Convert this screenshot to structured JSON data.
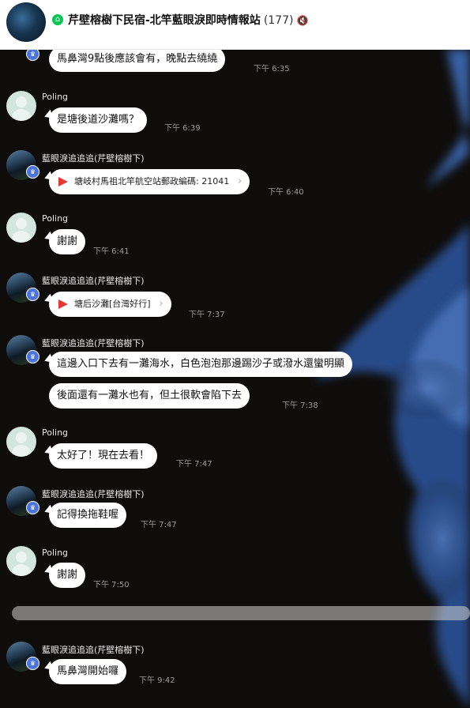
{
  "header": {
    "group_icon": "group-icon",
    "title": "芹壁榕樹下民宿-北竿藍眼淚即時情報站",
    "member_count": "(177)",
    "mute_icon": "speaker-mute-icon"
  },
  "colors": {
    "header_bg": "#ffffff",
    "chat_bg": "#0f0d0b",
    "bubble_bg": "#ffffff",
    "admin_badge": "#4a74d9",
    "group_badge": "#06c755",
    "link_play": "#e53935"
  },
  "messages": [
    {
      "sender": "",
      "text": "馬鼻灣9點後應該會有，晚點去繞繞",
      "time": "下午 6:35"
    },
    {
      "sender": "Poling",
      "text": "是塘後道沙灘嗎？",
      "time": "下午 6:39"
    },
    {
      "sender": "藍眼淚追追追(芹壁榕樹下)",
      "text": "塘岐村馬祖北竿航空站郵政編碼: 21041",
      "time": "下午 6:40"
    },
    {
      "sender": "Poling",
      "text": "謝謝",
      "time": "下午 6:41"
    },
    {
      "sender": "藍眼淚追追追(芹壁榕樹下)",
      "text": "塘后沙灘[台灣好行]",
      "time": "下午 7:37"
    },
    {
      "sender": "藍眼淚追追追(芹壁榕樹下)",
      "text": "這邊入口下去有一灘海水，白色泡泡那邊踢沙子或潑水還蠻明顯",
      "time": ""
    },
    {
      "sender": "",
      "text": "後面還有一灘水也有，但土很軟會陷下去",
      "time": "下午 7:38"
    },
    {
      "sender": "Poling",
      "text": "太好了！現在去看！",
      "time": "下午 7:47"
    },
    {
      "sender": "藍眼淚追追追(芹壁榕樹下)",
      "text": "記得換拖鞋喔",
      "time": "下午 7:47"
    },
    {
      "sender": "Poling",
      "text": "謝謝",
      "time": "下午 7:50"
    },
    {
      "sender": "藍眼淚追追追(芹壁榕樹下)",
      "text": "馬鼻灣開始囉",
      "time": "下午 9:42"
    }
  ]
}
